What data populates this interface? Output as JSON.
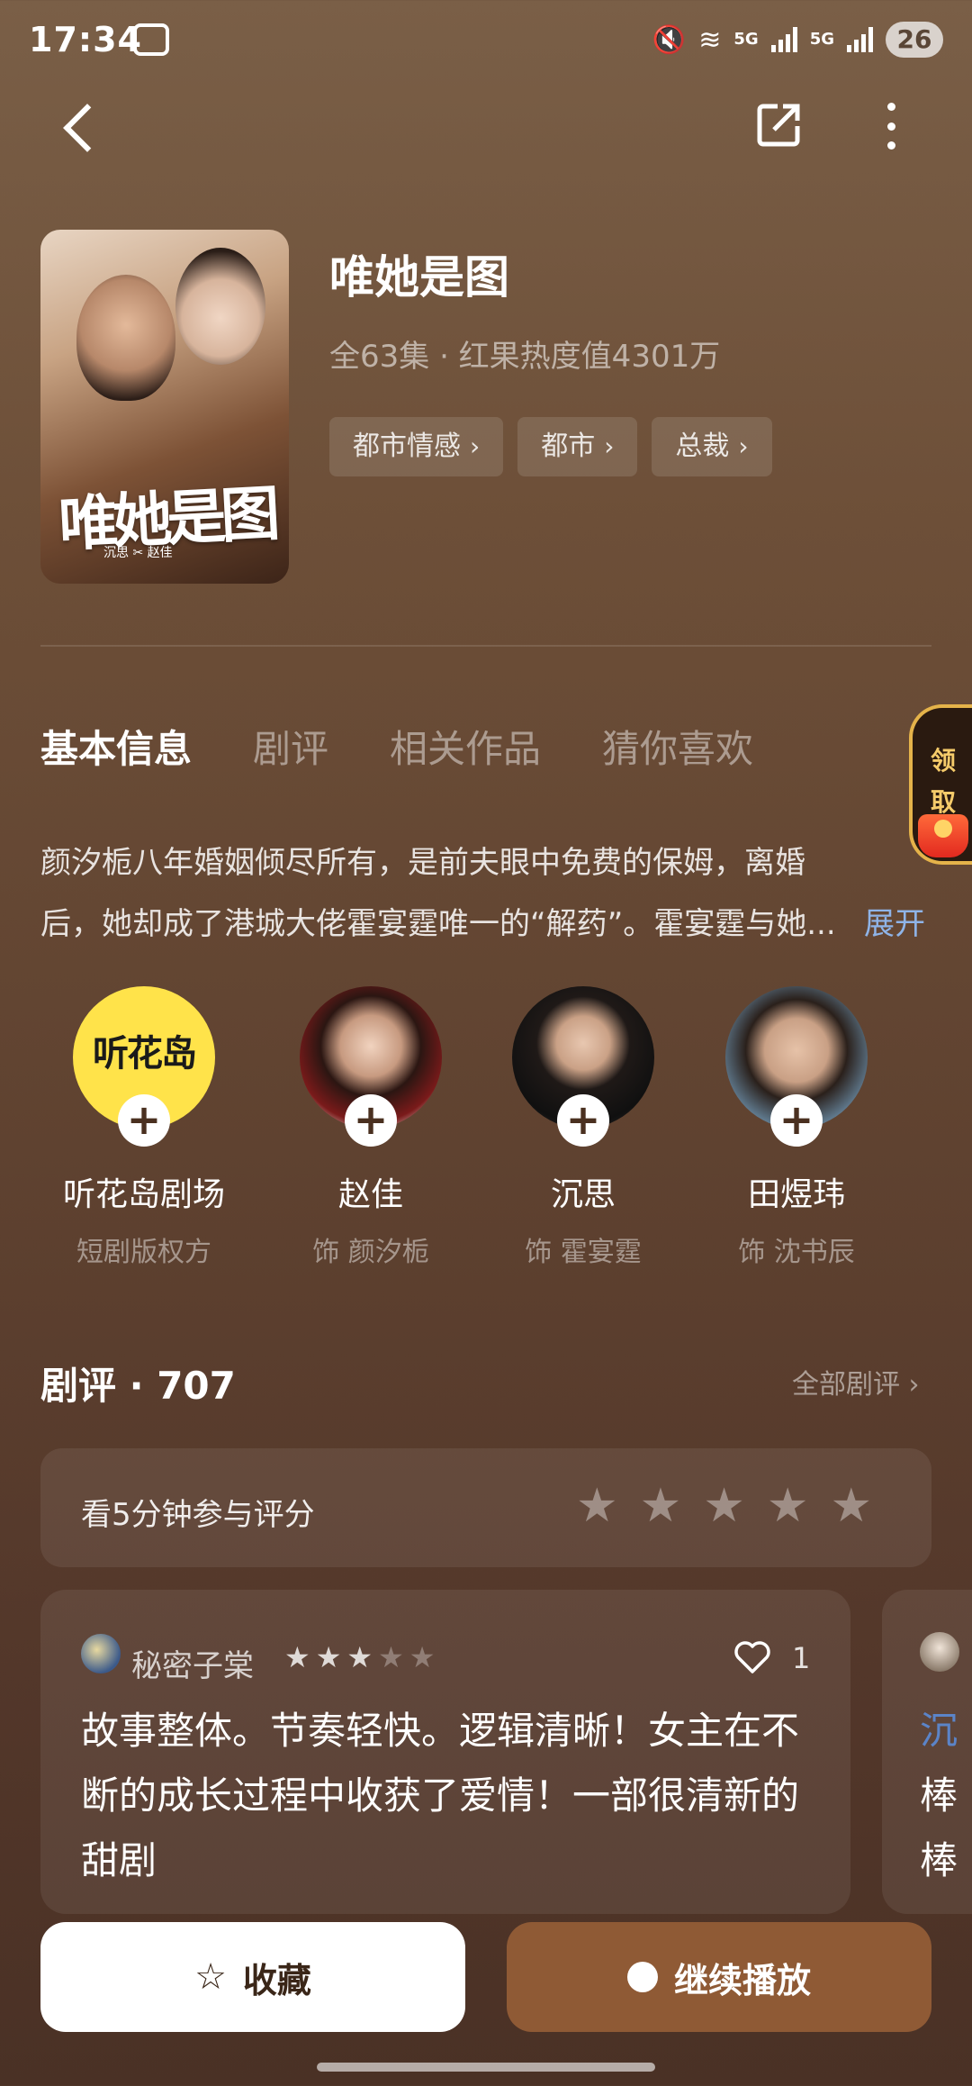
{
  "status_bar": {
    "time": "17:34",
    "network_5g_1": "5G",
    "network_5g_2": "5G",
    "battery": "26"
  },
  "drama": {
    "title": "唯她是图",
    "meta": "全63集 · 红果热度值4301万",
    "tags": [
      "都市情感",
      "都市",
      "总裁"
    ],
    "poster_title": "唯她是图",
    "poster_cast": "沉思 ✂ 赵佳"
  },
  "tabs": [
    "基本信息",
    "剧评",
    "相关作品",
    "猜你喜欢"
  ],
  "reward": {
    "line1": "领",
    "line2": "取"
  },
  "synopsis": {
    "text": "颜汐栀八年婚姻倾尽所有，是前夫眼中免费的保姆，离婚后，她却成了港城大佬霍宴霆唯一的“解药”。霍宴霆与她...",
    "expand_label": "展开"
  },
  "cast": [
    {
      "name": "听花岛剧场",
      "role": "短剧版权方",
      "logo_text": "听花岛"
    },
    {
      "name": "赵佳",
      "role": "饰 颜汐栀"
    },
    {
      "name": "沉思",
      "role": "饰 霍宴霆"
    },
    {
      "name": "田煜玮",
      "role": "饰 沈书辰"
    }
  ],
  "reviews": {
    "header": "剧评 · 707",
    "all_link": "全部剧评 ›",
    "rate_prompt": "看5分钟参与评分",
    "rate_star_count": 5,
    "items": [
      {
        "user": "秘密子棠",
        "rating": 3,
        "likes": "1",
        "text": "故事整体。节奏轻快。逻辑清晰！女主在不断的成长过程中收获了爱情！一部很清新的甜剧"
      }
    ],
    "peek_user": "沉",
    "peek_line1": "棒",
    "peek_line2": "棒"
  },
  "actions": {
    "favorite_label": "收藏",
    "play_label": "继续播放"
  },
  "colors": {
    "accent_play": "#8f5a35",
    "link_blue": "#8fb4e8",
    "reward_gold": "#e5b34a"
  }
}
